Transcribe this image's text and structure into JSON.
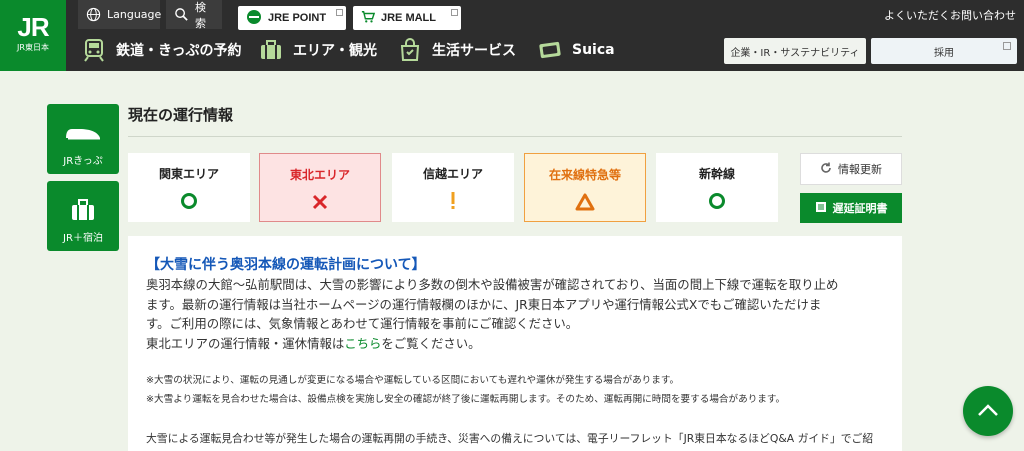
{
  "header": {
    "logo_text": "JR",
    "logo_sub": "JR東日本",
    "language_label": "Language",
    "search_label": "検索",
    "jre_point_label": "JRE POINT",
    "jre_mall_label": "JRE MALL",
    "inquiry_label": "よくいただくお問い合わせ",
    "nav": [
      {
        "label": "鉄道・きっぷの予約",
        "icon": "train-icon"
      },
      {
        "label": "エリア・観光",
        "icon": "suitcase-icon"
      },
      {
        "label": "生活サービス",
        "icon": "shopping-bag-icon"
      },
      {
        "label": "Suica",
        "icon": "card-icon"
      }
    ],
    "corporate_label": "企業・IR・サステナビリティ",
    "recruit_label": "採用"
  },
  "sidebar": {
    "items": [
      {
        "label": "JRきっぷ",
        "icon": "shinkansen-icon"
      },
      {
        "label": "JR＋宿泊",
        "icon": "luggage-icon"
      }
    ]
  },
  "main": {
    "title": "現在の運行情報",
    "areas": [
      {
        "label": "関東エリア",
        "status": "normal",
        "icon": "circle-icon"
      },
      {
        "label": "東北エリア",
        "status": "suspended",
        "icon": "cross-icon"
      },
      {
        "label": "信越エリア",
        "status": "caution",
        "icon": "exclamation-icon"
      },
      {
        "label": "在来線特急等",
        "status": "delay",
        "icon": "triangle-icon"
      },
      {
        "label": "新幹線",
        "status": "normal",
        "icon": "circle-icon"
      }
    ],
    "refresh_label": "情報更新",
    "certificate_label": "遅延証明書"
  },
  "notice": {
    "title": "【大雪に伴う奥羽本線の運転計画について】",
    "lines": [
      "奥羽本線の大館～弘前駅間は、大雪の影響により多数の倒木や設備被害が確認されており、当面の間上下線で運転を取り止め",
      "ます。最新の運行情報は当社ホームページの運行情報欄のほかに、JR東日本アプリや運行情報公式Xでもご確認いただけま",
      "す。ご利用の際には、気象情報とあわせて運行情報を事前にご確認ください。"
    ],
    "link_prefix": "東北エリアの運行情報・運休情報は",
    "link_text": "こちら",
    "link_suffix": "をご覧ください。",
    "note1": "※大雪の状況により、運転の見通しが変更になる場合や運転している区間においても遅れや運休が発生する場合があります。",
    "note2": "※大雪より運転を見合わせた場合は、設備点検を実施し安全の確認が終了後に運転再開します。そのため、運転再開に時間を要する場合があります。",
    "tail": "大雪による運転見合わせ等が発生した場合の運転再開の手続き、災害への備えについては、電子リーフレット「JR東日本なるほどQ&A ガイド」でご紹"
  },
  "colors": {
    "brand_green": "#0a8a2c",
    "header_dark": "#2d2d2d",
    "alert_red": "#d9262a",
    "alert_orange": "#e07010",
    "caution_yellow": "#f0a020"
  }
}
